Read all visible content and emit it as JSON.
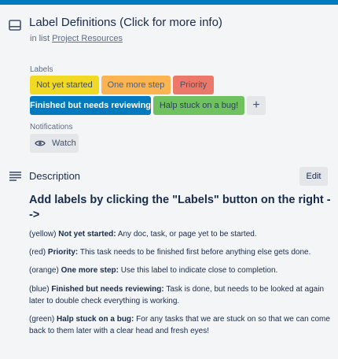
{
  "card": {
    "title": "Label Definitions (Click for more info)",
    "in_list_prefix": "in list",
    "list_name": "Project Resources"
  },
  "labels_section": {
    "heading": "Labels",
    "items": [
      {
        "text": "Not yet started",
        "color": "yellow"
      },
      {
        "text": "One more step",
        "color": "orange"
      },
      {
        "text": "Priority",
        "color": "red"
      },
      {
        "text": "Finished but needs reviewing",
        "color": "blue"
      },
      {
        "text": "Halp stuck on a bug!",
        "color": "green"
      }
    ],
    "add_symbol": "+"
  },
  "notifications": {
    "heading": "Notifications",
    "watch_label": "Watch"
  },
  "description": {
    "heading": "Description",
    "edit_label": "Edit",
    "lead": "Add labels by clicking the \"Labels\" button on the right -->",
    "paragraphs": [
      {
        "prefix": "(yellow)",
        "term": "Not yet started:",
        "text": "Any doc, task, or page yet to be started."
      },
      {
        "prefix": "(red)",
        "term": "Priority:",
        "text": "This task needs to be finished first before anything else gets done."
      },
      {
        "prefix": "(orange)",
        "term": "One more step:",
        "text": "Use this label to indicate close to completion."
      },
      {
        "prefix": "(blue)",
        "term": "Finished but needs reviewing:",
        "text": "Task is done, but needs to be looked at again later to double check everything is working."
      },
      {
        "prefix": "(green)",
        "term": "Halp stuck on a bug:",
        "text": "For any tasks that we are stuck on so that we can come back to them later with a clear head and fresh eyes!"
      }
    ]
  },
  "colors": {
    "accent": "#0079bf",
    "yellow": "#f2d600",
    "orange": "#ff9f1a",
    "red": "#eb5a46",
    "blue": "#0079bf",
    "green": "#61bd4f"
  },
  "icons": [
    "card-icon",
    "eye-icon",
    "description-icon",
    "plus-icon"
  ]
}
